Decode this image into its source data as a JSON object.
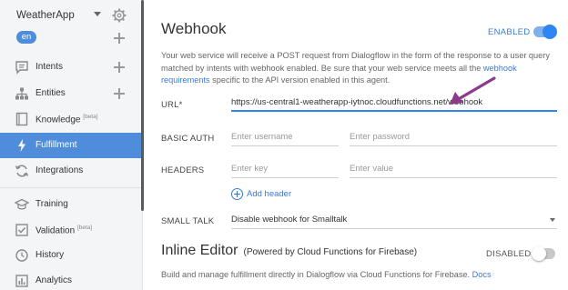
{
  "sidebar": {
    "agent_name": "WeatherApp",
    "language": "en",
    "items": [
      {
        "label": "Intents",
        "icon": "chat-icon",
        "badge": ""
      },
      {
        "label": "Entities",
        "icon": "hierarchy-icon",
        "badge": ""
      },
      {
        "label": "Knowledge",
        "icon": "book-icon",
        "badge": "[beta]"
      },
      {
        "label": "Fulfillment",
        "icon": "bolt-icon",
        "badge": ""
      },
      {
        "label": "Integrations",
        "icon": "sync-icon",
        "badge": ""
      },
      {
        "label": "Training",
        "icon": "graduation-cap-icon",
        "badge": ""
      },
      {
        "label": "Validation",
        "icon": "checkbox-icon",
        "badge": "[beta]"
      },
      {
        "label": "History",
        "icon": "clock-icon",
        "badge": ""
      },
      {
        "label": "Analytics",
        "icon": "chart-icon",
        "badge": ""
      }
    ],
    "active_item": "Fulfillment",
    "accent_color": "#4f8cd9"
  },
  "webhook": {
    "title": "Webhook",
    "status_label": "ENABLED",
    "enabled": true,
    "description_pre": "Your web service will receive a POST request from Dialogflow in the form of the response to a user query matched by intents with webhook enabled. Be sure that your web service meets all the ",
    "description_link": "webhook requirements",
    "description_post": " specific to the API version enabled in this agent.",
    "url_label": "URL*",
    "url_value": "https://us-central1-weatherapp-iytnoc.cloudfunctions.net/webhook",
    "basic_auth_label": "BASIC AUTH",
    "username_placeholder": "Enter username",
    "password_placeholder": "Enter password",
    "headers_label": "HEADERS",
    "key_placeholder": "Enter key",
    "value_placeholder": "Enter value",
    "add_header_label": "Add header",
    "small_talk_label": "SMALL TALK",
    "small_talk_value": "Disable webhook for Smalltalk"
  },
  "inline_editor": {
    "title": "Inline Editor",
    "subtitle": "(Powered by Cloud Functions for Firebase)",
    "status_label": "DISABLED",
    "enabled": false,
    "description": "Build and manage fulfillment directly in Dialogflow via Cloud Functions for Firebase.",
    "docs_link": "Docs"
  },
  "annotation_color": "#8e3a8a",
  "link_color": "#3a7bd5"
}
